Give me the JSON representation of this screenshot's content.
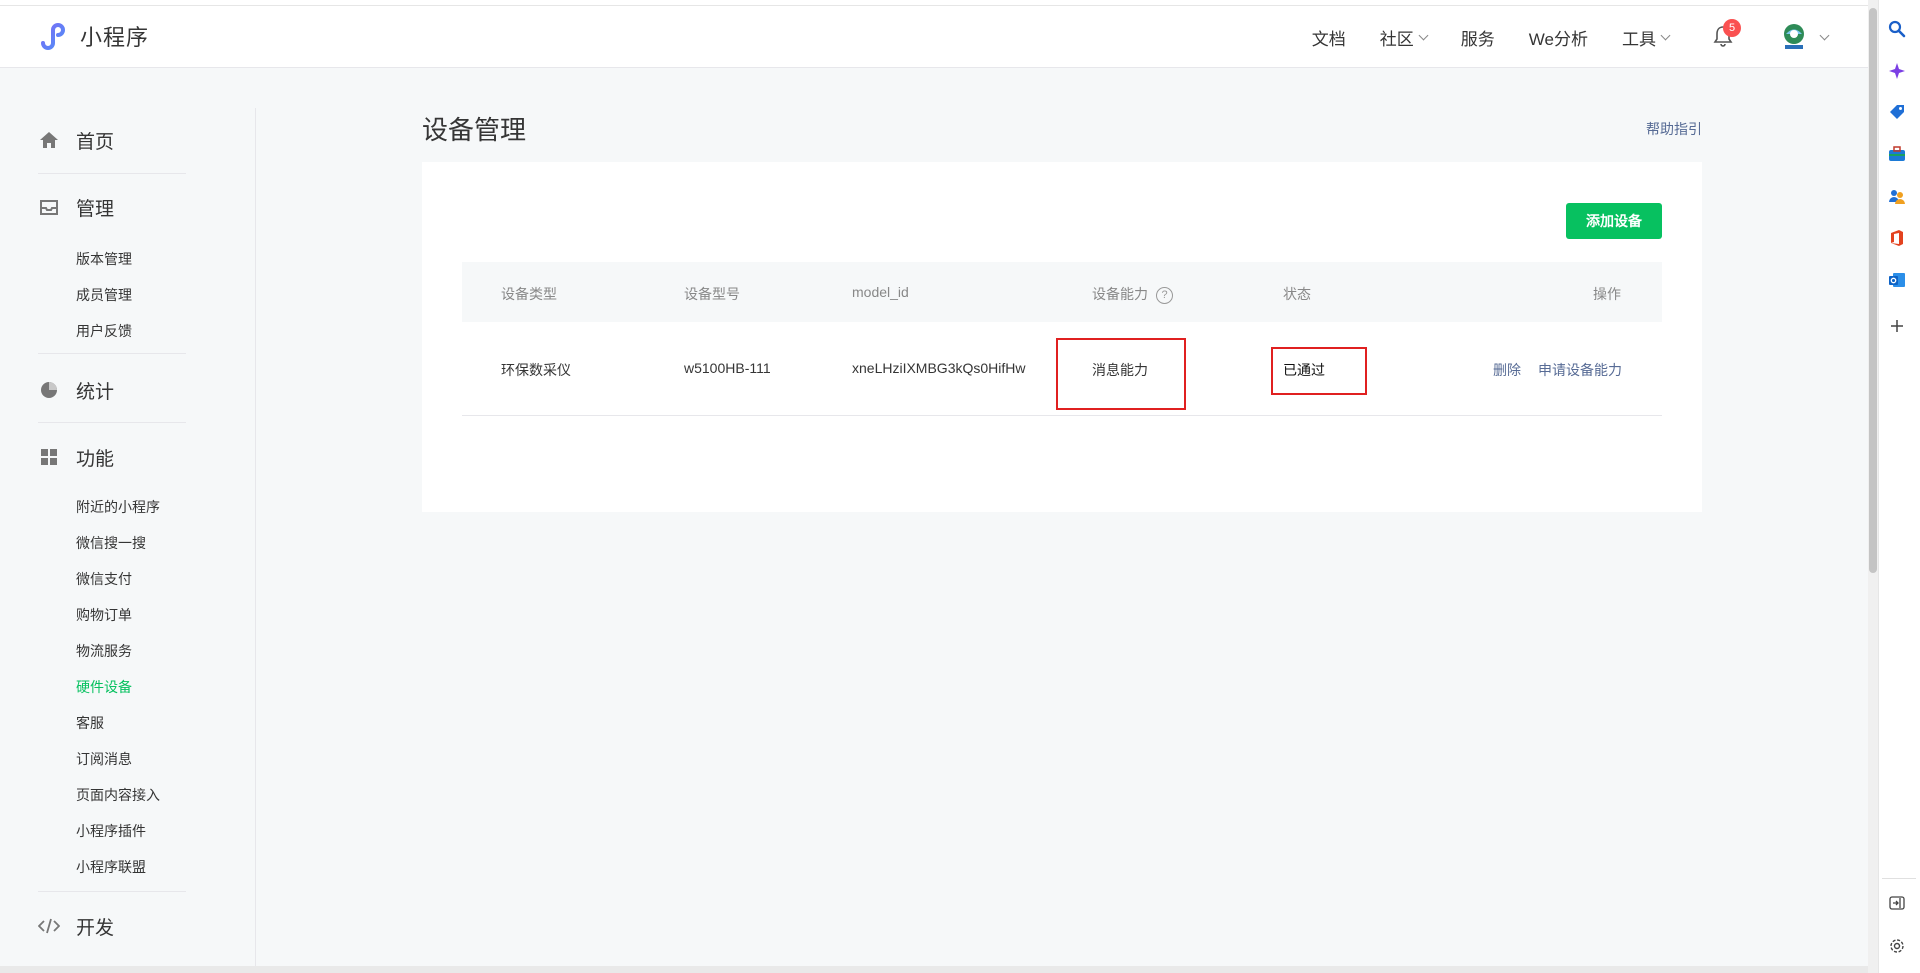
{
  "header": {
    "app_name": "小程序",
    "nav": [
      {
        "label": "文档",
        "has_caret": false
      },
      {
        "label": "社区",
        "has_caret": true
      },
      {
        "label": "服务",
        "has_caret": false
      },
      {
        "label": "We分析",
        "has_caret": false
      },
      {
        "label": "工具",
        "has_caret": true
      }
    ],
    "notification_count": "5"
  },
  "sidebar": {
    "home": "首页",
    "manage": {
      "title": "管理",
      "items": [
        "版本管理",
        "成员管理",
        "用户反馈"
      ]
    },
    "stats": "统计",
    "features": {
      "title": "功能",
      "items": [
        "附近的小程序",
        "微信搜一搜",
        "微信支付",
        "购物订单",
        "物流服务",
        "硬件设备",
        "客服",
        "订阅消息",
        "页面内容接入",
        "小程序插件",
        "小程序联盟"
      ],
      "active": "硬件设备"
    },
    "develop": "开发"
  },
  "main": {
    "title": "设备管理",
    "help_link": "帮助指引",
    "add_button": "添加设备",
    "table": {
      "columns": [
        "设备类型",
        "设备型号",
        "model_id",
        "设备能力",
        "状态",
        "操作"
      ],
      "capability_help": "?",
      "rows": [
        {
          "type": "环保数采仪",
          "model": "w5100HB-111",
          "model_id": "xneLHziIXMBG3kQs0HifHw",
          "capability": "消息能力",
          "status": "已通过",
          "actions": [
            "删除",
            "申请设备能力"
          ]
        }
      ]
    }
  },
  "colors": {
    "accent_green": "#07c160",
    "link_blue": "#576b95",
    "highlight_red": "#e02020",
    "badge_red": "#fa5151"
  },
  "icons": {
    "header": [
      "miniprogram-logo-icon",
      "bell-icon",
      "avatar",
      "chevron-down-icon"
    ],
    "sidebar": [
      "home-icon",
      "inbox-icon",
      "pie-chart-icon",
      "grid-icon",
      "code-icon"
    ],
    "side_panel": [
      "search-icon",
      "sparkle-icon",
      "tag-icon",
      "toolbox-icon",
      "people-icon",
      "office-icon",
      "outlook-icon",
      "plus-icon",
      "panel-toggle-icon",
      "settings-icon"
    ]
  }
}
